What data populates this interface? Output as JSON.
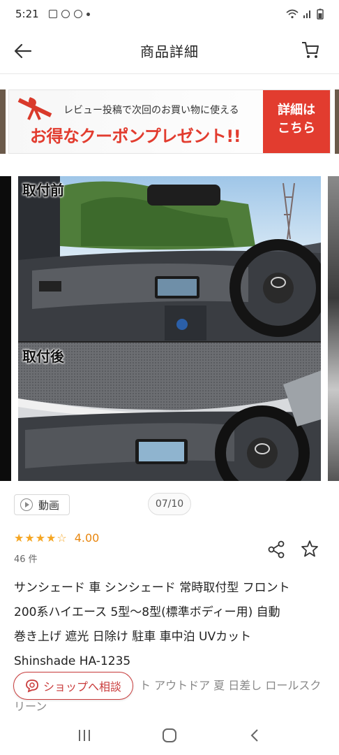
{
  "status_bar": {
    "time": "5:21",
    "icons": [
      "image-icon",
      "notification-icon",
      "chrome-icon",
      "dot-icon"
    ],
    "right_icons": [
      "wifi-icon",
      "signal-icon",
      "battery-icon"
    ]
  },
  "header": {
    "title": "商品詳細",
    "back_icon": "back-arrow-icon",
    "cart_icon": "cart-icon"
  },
  "banner": {
    "line1": "レビュー投稿で次回のお買い物に使える",
    "line2": "お得なクーポンプレゼント!!",
    "cta_line1": "詳細は",
    "cta_line2": "こちら"
  },
  "gallery": {
    "label_before": "取付前",
    "label_after": "取付後",
    "counter": "07/10"
  },
  "video_chip": {
    "label": "動画"
  },
  "rating": {
    "stars_filled": 4,
    "stars_total": 5,
    "value": "4.00",
    "review_count": "46 件"
  },
  "product": {
    "title_lines": [
      "サンシェード 車 シンシェード 常時取付型 フロント",
      "200系ハイエース 5型～8型(標準ボディー用) 自動",
      "巻き上げ 遮光 日除け 駐車 車中泊 UVカット",
      "Shinshade HA-1235"
    ],
    "subtitle_line1": "ト アウトドア 夏 日差し ロールスク",
    "subtitle_line2": "リーン"
  },
  "consult_button": {
    "label": "ショップへ相談"
  },
  "colors": {
    "accent_red": "#c93b3b",
    "star": "#f5a623",
    "rating_text": "#e8860e",
    "banner_red": "#e23c2f"
  }
}
